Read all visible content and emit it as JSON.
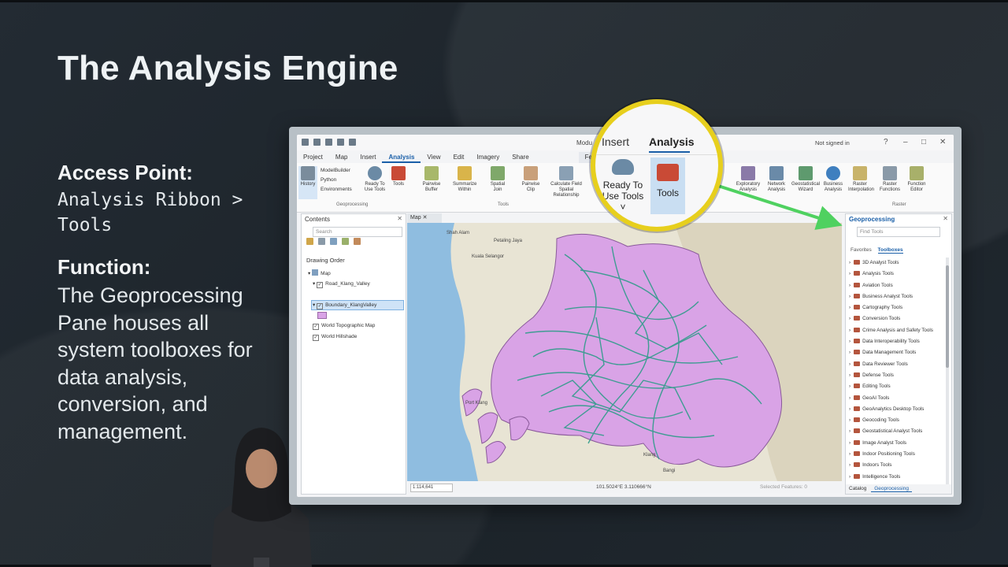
{
  "slide": {
    "title": "The Analysis Engine",
    "access_label": "Access Point:",
    "access_path_line1": "Analysis Ribbon >",
    "access_path_line2": "Tools",
    "function_label": "Function:",
    "function_text": "The Geoprocessing Pane houses all system toolboxes for data analysis, conversion, and management."
  },
  "app": {
    "title_center": "Modu",
    "signed_in": "Not signed in",
    "ribbon_tabs": [
      "Project",
      "Map",
      "Insert",
      "Analysis",
      "View",
      "Edit",
      "Imagery",
      "Share",
      "Feature Layer"
    ],
    "active_tab": "Analysis",
    "ribbon_left": {
      "history": "History",
      "modelbuilder": "ModelBuilder",
      "python": "Python",
      "environments": "Environments",
      "ready_to_use": "Ready To Use Tools",
      "tools": "Tools",
      "group": "Geoprocessing"
    },
    "tool_buttons": [
      "Pairwise Buffer",
      "Summarize Within",
      "Spatial Join",
      "Pairwise Clip",
      "Calculate Field Spatial Relationship"
    ],
    "tool_group": "Tools",
    "right_buttons": [
      "Exploratory Analysis",
      "Network Analysis",
      "Geostatistical Wizard",
      "Business Analysis",
      "Raster Interpolation",
      "Raster Functions",
      "Function Editor"
    ],
    "raster_group": "Raster"
  },
  "contents": {
    "title": "Contents",
    "search_placeholder": "Search",
    "drawing_order": "Drawing Order",
    "layers": {
      "map": "Map",
      "road": "Road_Klang_Valley",
      "boundary": "Boundary_KlangValley",
      "topo": "World Topographic Map",
      "hillshade": "World Hillshade"
    }
  },
  "map": {
    "tab": "Map",
    "scale": "1:114,641",
    "coords": "101.5024°E 3.110666°N",
    "selected_features": "Selected Features: 0",
    "place_labels": [
      "Shah Alam",
      "Petaling Jaya",
      "Kuala Selangor",
      "Port Klang",
      "Klang",
      "Bangi"
    ]
  },
  "geoprocessing": {
    "title": "Geoprocessing",
    "search_placeholder": "Find Tools",
    "tab_favorites": "Favorites",
    "tab_toolboxes": "Toolboxes",
    "toolboxes": [
      "3D Analyst Tools",
      "Analysis Tools",
      "Aviation Tools",
      "Business Analyst Tools",
      "Cartography Tools",
      "Conversion Tools",
      "Crime Analysis and Safety Tools",
      "Data Interoperability Tools",
      "Data Management Tools",
      "Data Reviewer Tools",
      "Defense Tools",
      "Editing Tools",
      "GeoAI Tools",
      "GeoAnalytics Desktop Tools",
      "Geocoding Tools",
      "Geostatistical Analyst Tools",
      "Image Analyst Tools",
      "Indoor Positioning Tools",
      "Indoors Tools",
      "Intelligence Tools"
    ],
    "footer_catalog": "Catalog",
    "footer_geoprocessing": "Geoprocessing"
  },
  "callout": {
    "insert": "Insert",
    "analysis": "Analysis",
    "ready_line1": "Ready To",
    "ready_line2": "Use Tools ˅",
    "tools": "Tools"
  },
  "colors": {
    "highlight_ring": "#e7cf1d",
    "arrow": "#4fd160",
    "road_network": "#2f9c8a",
    "boundary_fill": "#d9a3e6",
    "water": "#8fbde0"
  }
}
